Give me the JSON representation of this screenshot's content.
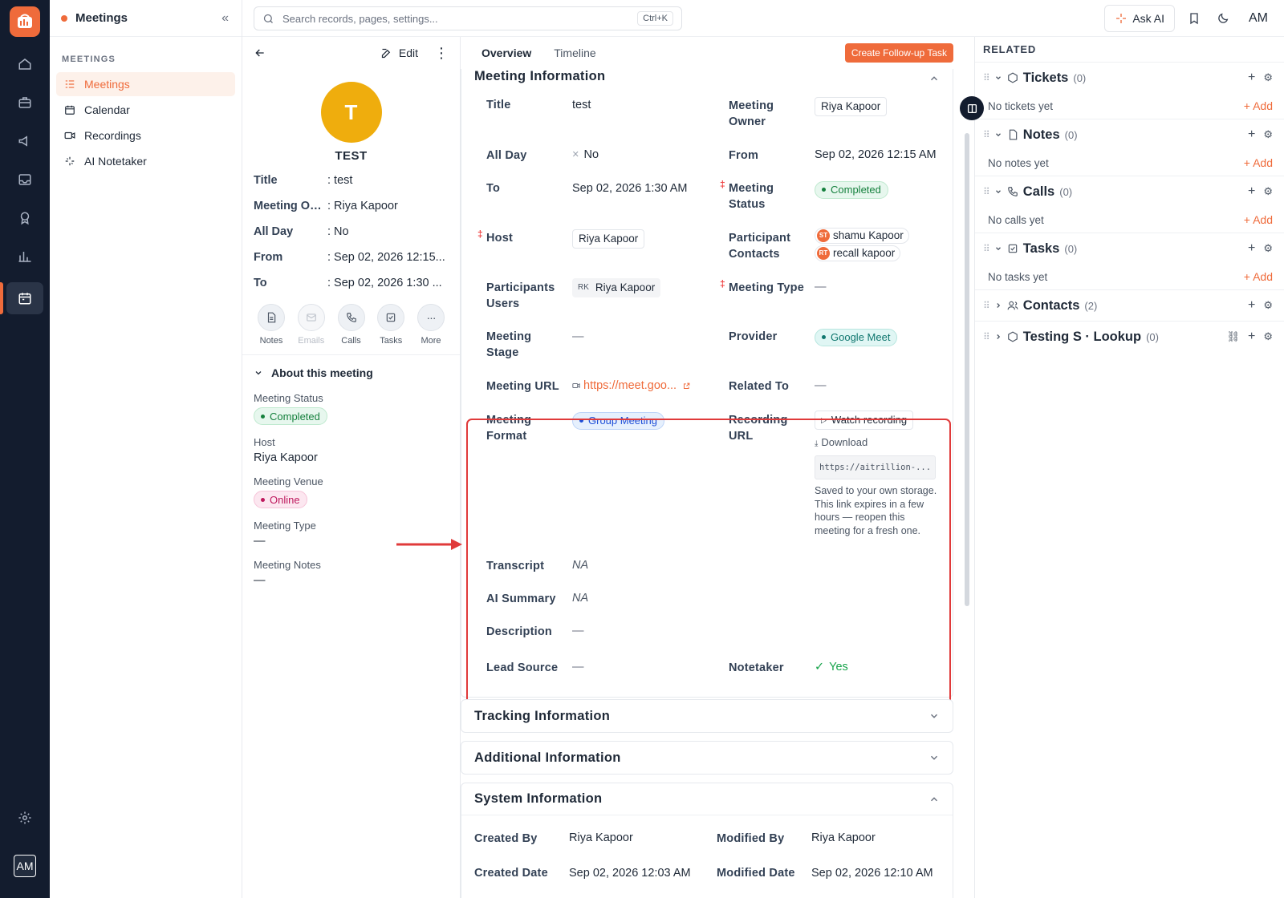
{
  "app": {
    "section": "Meetings"
  },
  "nav": {
    "section_label": "MEETINGS",
    "items": [
      {
        "label": "Meetings",
        "icon": "list-icon"
      },
      {
        "label": "Calendar",
        "icon": "calendar-icon"
      },
      {
        "label": "Recordings",
        "icon": "video-icon"
      },
      {
        "label": "AI Notetaker",
        "icon": "sparkles-icon"
      }
    ]
  },
  "rail": {
    "avatar": "AM"
  },
  "topbar": {
    "search_placeholder": "Search records, pages, settings...",
    "shortcut": "Ctrl+K",
    "ask_ai": "Ask AI",
    "avatar": "AM"
  },
  "record": {
    "edit_label": "Edit",
    "avatar_initial": "T",
    "name": "TEST",
    "fields": [
      {
        "label": "Title",
        "value": ": test"
      },
      {
        "label": "Meeting Ow...",
        "value": ": Riya Kapoor"
      },
      {
        "label": "All Day",
        "value": ": No"
      },
      {
        "label": "From",
        "value": ": Sep 02, 2026 12:15..."
      },
      {
        "label": "To",
        "value": ": Sep 02, 2026 1:30 ..."
      }
    ],
    "quick_actions": [
      {
        "label": "Notes",
        "icon": "note-icon",
        "enabled": true
      },
      {
        "label": "Emails",
        "icon": "mail-icon",
        "enabled": false
      },
      {
        "label": "Calls",
        "icon": "phone-icon",
        "enabled": true
      },
      {
        "label": "Tasks",
        "icon": "task-icon",
        "enabled": true
      },
      {
        "label": "More",
        "icon": "more-icon",
        "enabled": true
      }
    ],
    "about": {
      "title": "About this meeting",
      "status_label": "Meeting Status",
      "status": "Completed",
      "host_label": "Host",
      "host": "Riya Kapoor",
      "venue_label": "Meeting Venue",
      "venue": "Online",
      "type_label": "Meeting Type",
      "type": "—",
      "notes_label": "Meeting Notes",
      "notes": "—"
    }
  },
  "tabs": [
    "Overview",
    "Timeline"
  ],
  "create_task": "Create Follow-up Task",
  "meeting_info": {
    "title": "Meeting Information",
    "title_label": "Title",
    "title_value": "test",
    "owner_label": "Meeting Owner",
    "owner": "Riya Kapoor",
    "allday_label": "All Day",
    "allday": "No",
    "from_label": "From",
    "from": "Sep 02, 2026 12:15 AM",
    "to_label": "To",
    "to": "Sep 02, 2026 1:30 AM",
    "status_label": "Meeting Status",
    "status": "Completed",
    "host_label": "Host",
    "host": "Riya Kapoor",
    "contacts_label": "Participant Contacts",
    "contacts": [
      {
        "initials": "ST",
        "name": "shamu Kapoor"
      },
      {
        "initials": "RT",
        "name": "recall kapoor"
      }
    ],
    "users_label": "Participants Users",
    "user_initials": "RK",
    "user": "Riya Kapoor",
    "mtype_label": "Meeting Type",
    "mtype": "—",
    "stage_label": "Meeting Stage",
    "stage": "—",
    "provider_label": "Provider",
    "provider": "Google Meet",
    "url_label": "Meeting URL",
    "url": "https://meet.goo...",
    "related_label": "Related To",
    "related": "—",
    "format_label": "Meeting Format",
    "format": "Group Meeting",
    "recording_label": "Recording URL",
    "watch": "Watch recording",
    "download": "Download",
    "recording_url": "https://aitrillion-...",
    "recording_note": "Saved to your own storage. This link expires in a few hours — reopen this meeting for a fresh one.",
    "transcript_label": "Transcript",
    "transcript": "NA",
    "summary_label": "AI Summary",
    "summary": "NA",
    "desc_label": "Description",
    "desc": "—",
    "lead_label": "Lead Source",
    "lead": "—",
    "notetaker_label": "Notetaker",
    "notetaker": "Yes"
  },
  "tracking": {
    "title": "Tracking Information"
  },
  "additional": {
    "title": "Additional Information"
  },
  "system": {
    "title": "System Information",
    "created_by_label": "Created By",
    "created_by": "Riya Kapoor",
    "modified_by_label": "Modified By",
    "modified_by": "Riya Kapoor",
    "created_date_label": "Created Date",
    "created_date": "Sep 02, 2026 12:03 AM",
    "modified_date_label": "Modified Date",
    "modified_date": "Sep 02, 2026 12:10 AM"
  },
  "related": {
    "title": "RELATED",
    "add_label": "+ Add",
    "sections": [
      {
        "title": "Tickets",
        "count": "(0)",
        "empty": "No tickets yet"
      },
      {
        "title": "Notes",
        "count": "(0)",
        "empty": "No notes yet"
      },
      {
        "title": "Calls",
        "count": "(0)",
        "empty": "No calls yet"
      },
      {
        "title": "Tasks",
        "count": "(0)",
        "empty": "No tasks yet"
      },
      {
        "title": "Contacts",
        "count": "(2)"
      },
      {
        "title": "Testing S · Lookup",
        "count": "(0)"
      }
    ]
  },
  "colors": {
    "accent": "#ef6b3b",
    "rail": "#131c2e",
    "highlight": "#e03a3a"
  }
}
